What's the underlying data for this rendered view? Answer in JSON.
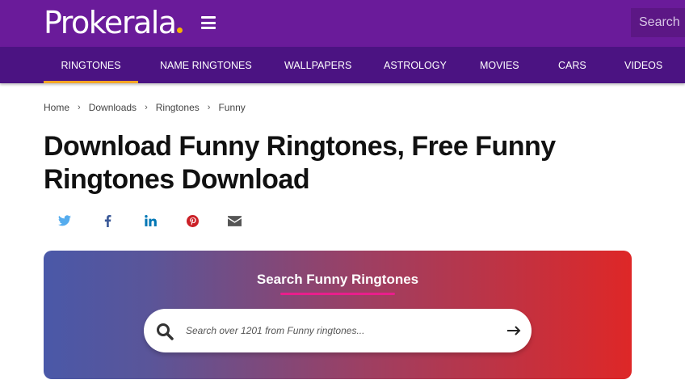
{
  "header": {
    "logo_text": "Prokerala",
    "search_placeholder": "Search"
  },
  "nav": {
    "items": [
      {
        "label": "RINGTONES",
        "active": true
      },
      {
        "label": "NAME RINGTONES",
        "active": false
      },
      {
        "label": "WALLPAPERS",
        "active": false
      },
      {
        "label": "ASTROLOGY",
        "active": false
      },
      {
        "label": "MOVIES",
        "active": false
      },
      {
        "label": "CARS",
        "active": false
      },
      {
        "label": "VIDEOS",
        "active": false
      }
    ]
  },
  "breadcrumb": {
    "items": [
      "Home",
      "Downloads",
      "Ringtones",
      "Funny"
    ],
    "separator": "›"
  },
  "page": {
    "title": "Download Funny Ringtones, Free Funny Ringtones Download"
  },
  "share": {
    "icons": [
      "twitter-icon",
      "facebook-icon",
      "linkedin-icon",
      "pinterest-icon",
      "email-icon"
    ]
  },
  "hero": {
    "title": "Search Funny Ringtones",
    "search_placeholder": "Search over 1201 from Funny ringtones..."
  },
  "colors": {
    "header_bg": "#6a1b9a",
    "nav_bg": "#4b1382",
    "active_underline": "#f5a623",
    "twitter": "#55acee",
    "facebook": "#3b5998",
    "linkedin": "#0077b5",
    "pinterest": "#cb2027",
    "email": "#555555",
    "hero_start": "#4a58a8",
    "hero_end": "#de2727",
    "hero_underline": "#e91e8c"
  }
}
